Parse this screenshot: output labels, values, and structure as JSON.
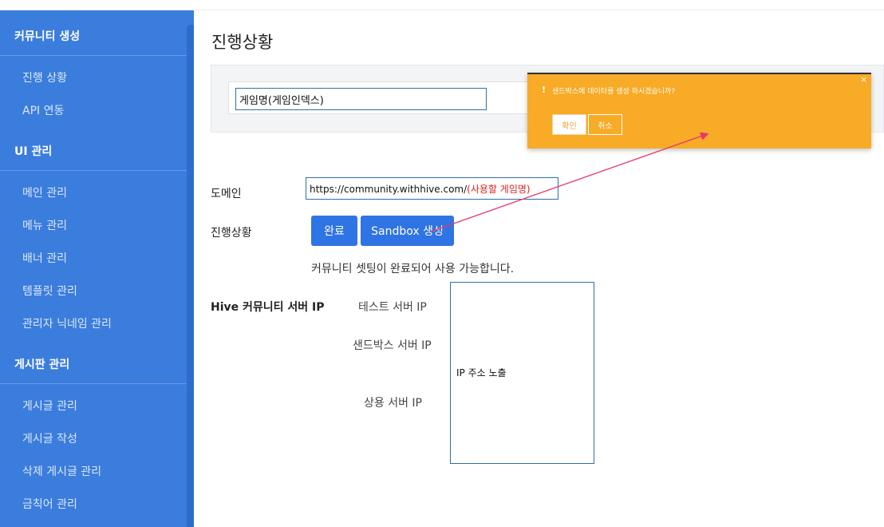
{
  "sidebar": {
    "sections": [
      {
        "title": "커뮤니티 생성",
        "items": [
          "진행 상황",
          "API 연동"
        ]
      },
      {
        "title": "UI 관리",
        "items": [
          "메인 관리",
          "메뉴 관리",
          "배너 관리",
          "템플릿 관리",
          "관리자 닉네임 관리"
        ]
      },
      {
        "title": "게시판 관리",
        "items": [
          "게시글 관리",
          "게시글 작성",
          "삭제 게시글 관리",
          "금칙어 관리"
        ]
      }
    ]
  },
  "main": {
    "title": "진행상황",
    "game_input_value": "게임명(게임인덱스)",
    "domain_label": "도메인",
    "domain_prefix": "https://community.withhive.com/",
    "domain_suffix": "(사용할 게임명)",
    "status_label": "진행상황",
    "btn_done": "완료",
    "btn_sandbox": "Sandbox 생성",
    "status_message": "커뮤니티 셋팅이 완료되어 사용 가능합니다.",
    "ip_section_label": "Hive 커뮤니티 서버 IP",
    "ip_test": "테스트 서버 IP",
    "ip_sandbox": "샌드박스 서버 IP",
    "ip_live": "상용 서버 IP",
    "ip_box_text": "IP 주소 노출"
  },
  "popup": {
    "icon": "!",
    "message": "샌드박스에 데이터를 생성 하시겠습니까?",
    "ok": "확인",
    "cancel": "취소",
    "close": "×"
  },
  "colors": {
    "sidebar": "#3b7ddd",
    "primary_button": "#2f74e4",
    "popup": "#f7ab26",
    "arrow": "#e8356f",
    "domain_highlight": "#e02020"
  }
}
